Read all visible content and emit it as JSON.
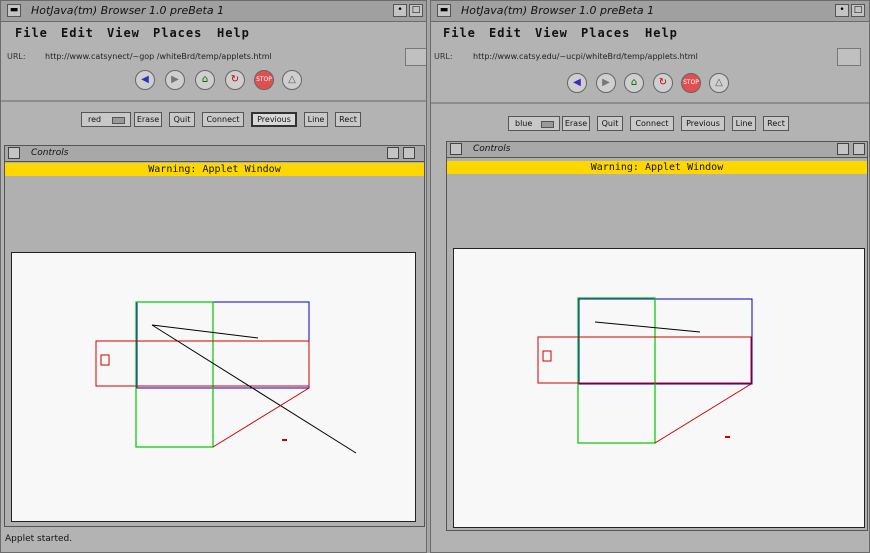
{
  "windows": {
    "left": {
      "title": "HotJava(tm) Browser 1.0 preBeta 1",
      "url_label": "URL:",
      "url": "http://www.catsynect/~gop /whiteBrd/temp/applets.html",
      "color_choice": "red",
      "frame_title": "Controls",
      "status": "Applet started."
    },
    "right": {
      "title": "HotJava(tm) Browser 1.0 preBeta 1",
      "url_label": "URL:",
      "url": "http://www.catsy.edu/~ucpi/whiteBrd/temp/applets.html",
      "color_choice": "blue",
      "frame_title": "Controls"
    }
  },
  "menu": [
    "File",
    "Edit",
    "View",
    "Places",
    "Help"
  ],
  "buttons": {
    "erase": "Erase",
    "quit": "Quit",
    "connect": "Connect",
    "previous": "Previous",
    "line": "Line",
    "rect": "Rect"
  },
  "warning": "Warning: Applet Window",
  "icons": {
    "back": "back-arrow-icon",
    "forward": "forward-arrow-icon",
    "home": "home-icon",
    "reload": "reload-icon",
    "stop": "stop-icon",
    "warn": "warning-triangle-icon"
  },
  "colors": {
    "warning_bar": "#ffd700",
    "red": "#d00000",
    "blue": "#0000c8",
    "green": "#00c800",
    "black": "#000000"
  }
}
